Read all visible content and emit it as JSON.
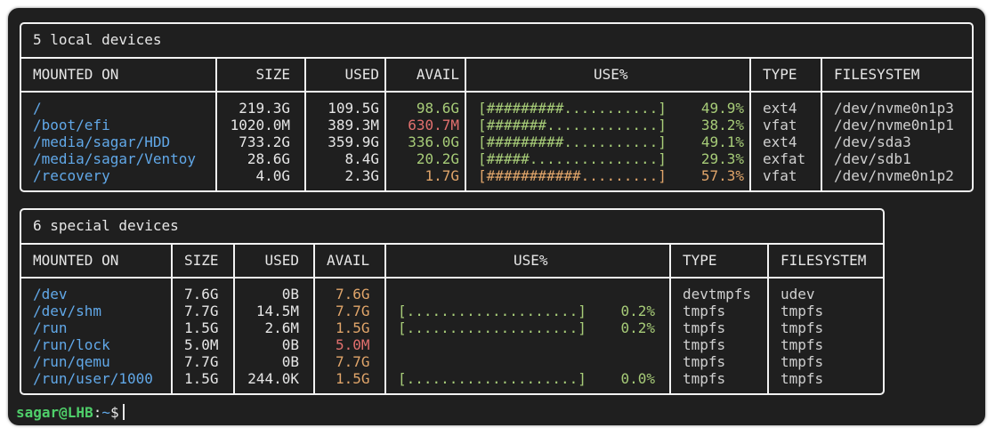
{
  "colors": {
    "mount": "#61a8e8",
    "green": "#a7cc78",
    "orange": "#e0a56a",
    "red": "#e2706e",
    "user": "#4fcf6a"
  },
  "local": {
    "title": "5 local devices",
    "headers": [
      "MOUNTED ON",
      "SIZE",
      "USED",
      "AVAIL",
      "USE%",
      "TYPE",
      "FILESYSTEM"
    ],
    "rows": [
      {
        "mount": "/",
        "size": "219.3G",
        "used": "109.5G",
        "avail": "98.6G",
        "avail_color": "green",
        "bar": "[#########...........]",
        "pct": "49.9%",
        "bar_color": "green",
        "type": "ext4",
        "fs": "/dev/nvme0n1p3"
      },
      {
        "mount": "/boot/efi",
        "size": "1020.0M",
        "used": "389.3M",
        "avail": "630.7M",
        "avail_color": "red",
        "bar": "[#######.............]",
        "pct": "38.2%",
        "bar_color": "green",
        "type": "vfat",
        "fs": "/dev/nvme0n1p1"
      },
      {
        "mount": "/media/sagar/HDD",
        "size": "733.2G",
        "used": "359.9G",
        "avail": "336.0G",
        "avail_color": "green",
        "bar": "[#########...........]",
        "pct": "49.1%",
        "bar_color": "green",
        "type": "ext4",
        "fs": "/dev/sda3"
      },
      {
        "mount": "/media/sagar/Ventoy",
        "size": "28.6G",
        "used": "8.4G",
        "avail": "20.2G",
        "avail_color": "green",
        "bar": "[#####...............]",
        "pct": "29.3%",
        "bar_color": "green",
        "type": "exfat",
        "fs": "/dev/sdb1"
      },
      {
        "mount": "/recovery",
        "size": "4.0G",
        "used": "2.3G",
        "avail": "1.7G",
        "avail_color": "orange",
        "bar": "[###########.........]",
        "pct": "57.3%",
        "bar_color": "orange",
        "type": "vfat",
        "fs": "/dev/nvme0n1p2"
      }
    ]
  },
  "special": {
    "title": "6 special devices",
    "headers": [
      "MOUNTED ON",
      "SIZE",
      "USED",
      "AVAIL",
      "USE%",
      "TYPE",
      "FILESYSTEM"
    ],
    "rows": [
      {
        "mount": "/dev",
        "size": "7.6G",
        "used": "0B",
        "avail": "7.6G",
        "avail_color": "orange",
        "bar": "",
        "pct": "",
        "bar_color": "green",
        "type": "devtmpfs",
        "fs": "udev"
      },
      {
        "mount": "/dev/shm",
        "size": "7.7G",
        "used": "14.5M",
        "avail": "7.7G",
        "avail_color": "orange",
        "bar": "[....................]",
        "pct": "0.2%",
        "bar_color": "green",
        "type": "tmpfs",
        "fs": "tmpfs"
      },
      {
        "mount": "/run",
        "size": "1.5G",
        "used": "2.6M",
        "avail": "1.5G",
        "avail_color": "orange",
        "bar": "[....................]",
        "pct": "0.2%",
        "bar_color": "green",
        "type": "tmpfs",
        "fs": "tmpfs"
      },
      {
        "mount": "/run/lock",
        "size": "5.0M",
        "used": "0B",
        "avail": "5.0M",
        "avail_color": "red",
        "bar": "",
        "pct": "",
        "bar_color": "green",
        "type": "tmpfs",
        "fs": "tmpfs"
      },
      {
        "mount": "/run/qemu",
        "size": "7.7G",
        "used": "0B",
        "avail": "7.7G",
        "avail_color": "orange",
        "bar": "",
        "pct": "",
        "bar_color": "green",
        "type": "tmpfs",
        "fs": "tmpfs"
      },
      {
        "mount": "/run/user/1000",
        "size": "1.5G",
        "used": "244.0K",
        "avail": "1.5G",
        "avail_color": "orange",
        "bar": "[....................]",
        "pct": "0.0%",
        "bar_color": "green",
        "type": "tmpfs",
        "fs": "tmpfs"
      }
    ]
  },
  "prompt": {
    "user": "sagar@LHB",
    "sep": ":",
    "path": "~",
    "symbol": "$"
  }
}
